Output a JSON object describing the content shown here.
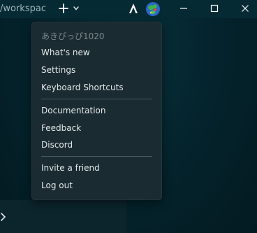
{
  "titlebar": {
    "path_text": "/workspac"
  },
  "icons": {
    "new_tab": "plus-icon",
    "new_tab_menu": "chevron-down-icon",
    "logo": "warp-logo-icon",
    "avatar": "user-avatar-icon",
    "minimize": "minimize-icon",
    "maximize": "maximize-icon",
    "close": "close-icon",
    "panel": "chevron-right-icon"
  },
  "menu": {
    "username": "あきぴっぴ1020",
    "whats_new": "What's new",
    "settings": "Settings",
    "keyboard_shortcuts": "Keyboard Shortcuts",
    "documentation": "Documentation",
    "feedback": "Feedback",
    "discord": "Discord",
    "invite_friend": "Invite a friend",
    "log_out": "Log out"
  },
  "colors": {
    "background": "#04222b",
    "menu_bg": "#1a2b31",
    "menu_text": "#e3e8ea",
    "muted_text": "#7d8a8e"
  }
}
